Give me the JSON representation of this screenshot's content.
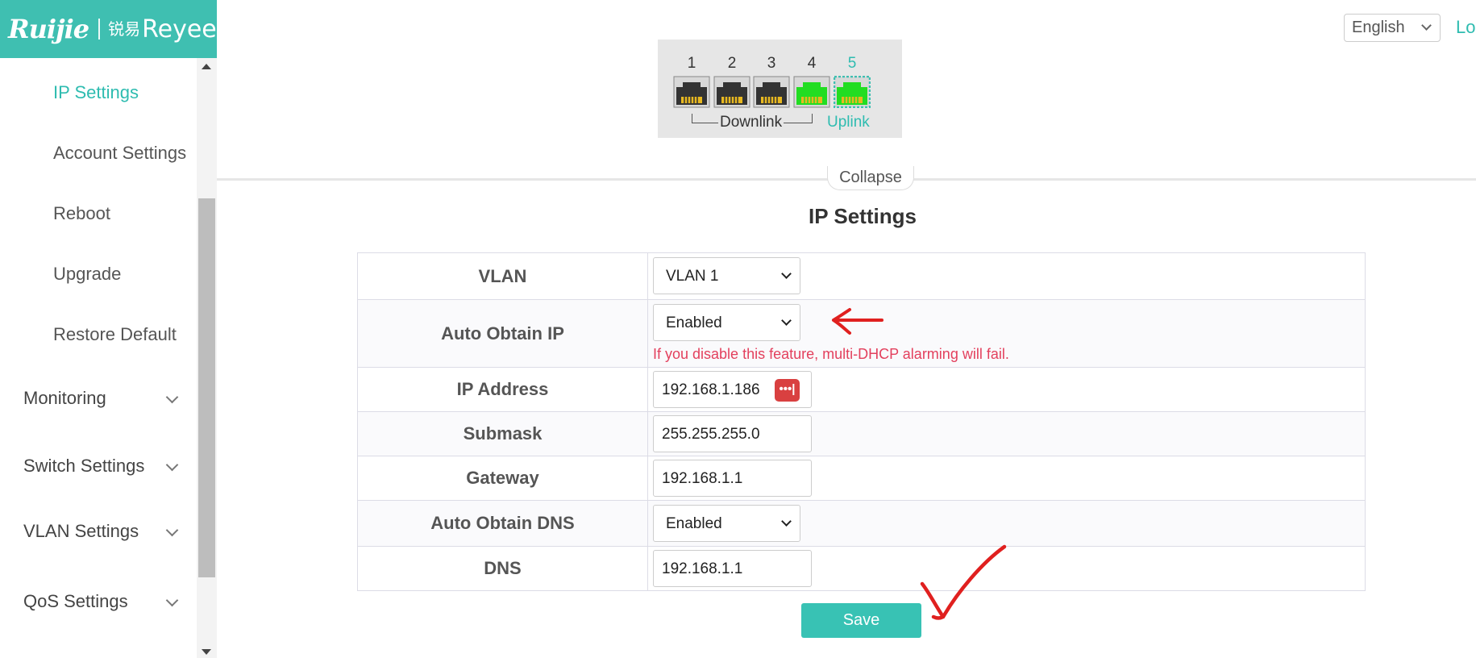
{
  "brand": {
    "left": "Ruijie",
    "right": "Reyee",
    "right_prefix": "锐易"
  },
  "header": {
    "language": "English",
    "logout_label": "Lo"
  },
  "sidebar": {
    "sub_items": [
      {
        "label": "IP Settings",
        "active": true
      },
      {
        "label": "Account Settings"
      },
      {
        "label": "Reboot"
      },
      {
        "label": "Upgrade"
      },
      {
        "label": "Restore Default"
      }
    ],
    "groups": [
      {
        "label": "Monitoring"
      },
      {
        "label": "Switch Settings"
      },
      {
        "label": "VLAN Settings"
      },
      {
        "label": "QoS Settings"
      }
    ]
  },
  "ports": {
    "numbers": [
      "1",
      "2",
      "3",
      "4",
      "5"
    ],
    "status": [
      "down",
      "down",
      "down",
      "up",
      "up-uplink"
    ],
    "downlink_label": "Downlink",
    "uplink_label": "Uplink"
  },
  "collapse_label": "Collapse",
  "form": {
    "title": "IP Settings",
    "vlan": {
      "label": "VLAN",
      "value": "VLAN 1"
    },
    "auto_ip": {
      "label": "Auto Obtain IP",
      "value": "Enabled",
      "hint": "If you disable this feature, multi-DHCP alarming will fail."
    },
    "ip": {
      "label": "IP Address",
      "value": "192.168.1.186",
      "icon": "•••|"
    },
    "mask": {
      "label": "Submask",
      "value": "255.255.255.0"
    },
    "gateway": {
      "label": "Gateway",
      "value": "192.168.1.1"
    },
    "auto_dns": {
      "label": "Auto Obtain DNS",
      "value": "Enabled"
    },
    "dns": {
      "label": "DNS",
      "value": "192.168.1.1"
    },
    "save_label": "Save"
  },
  "colors": {
    "accent": "#3fbfb1",
    "port_up": "#22dd22",
    "port_down": "#333333",
    "hint": "#e3405d",
    "annotation": "#e0201f"
  }
}
